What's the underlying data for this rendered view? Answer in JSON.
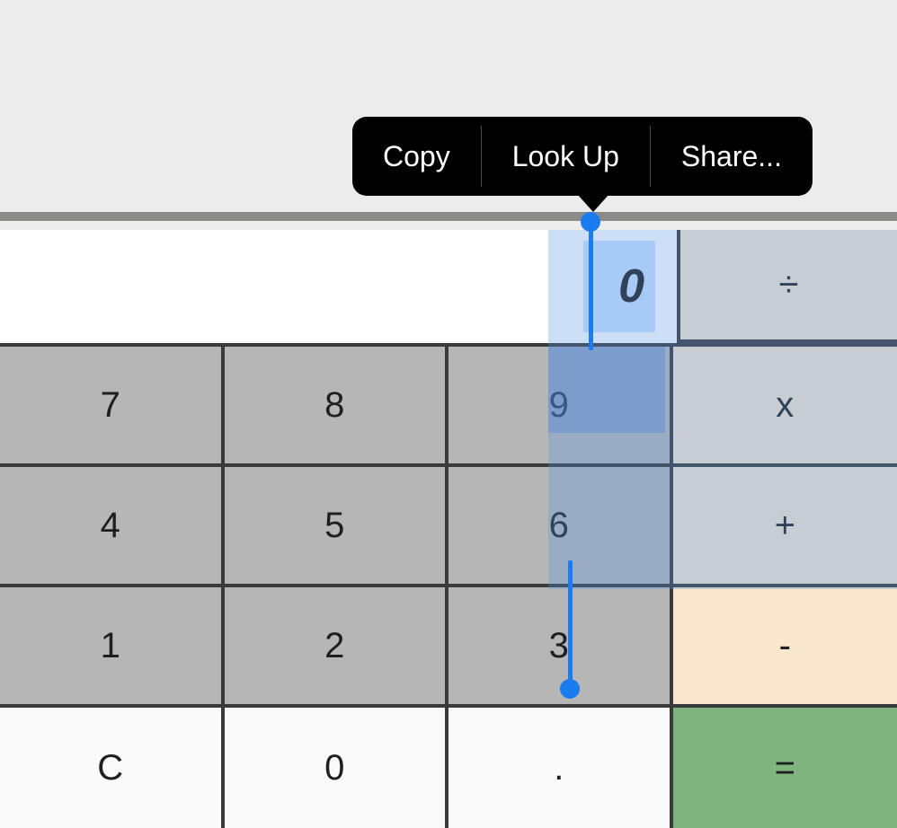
{
  "context_menu": {
    "items": [
      "Copy",
      "Look Up",
      "Share..."
    ]
  },
  "display": {
    "value": "0"
  },
  "operators": {
    "divide": "÷",
    "multiply": "x",
    "add": "+",
    "subtract": "-",
    "equals": "="
  },
  "keys": {
    "n7": "7",
    "n8": "8",
    "n9": "9",
    "n4": "4",
    "n5": "5",
    "n6": "6",
    "n1": "1",
    "n2": "2",
    "n3": "3",
    "clear": "C",
    "n0": "0",
    "dot": "."
  },
  "colors": {
    "page_bg": "#ececec",
    "num_key_bg": "#b6b6b6",
    "op_key_bg": "#f8e6cd",
    "util_key_bg": "#fafafa",
    "equals_bg": "#80b47e",
    "selection_blue": "#1b7cf2"
  }
}
